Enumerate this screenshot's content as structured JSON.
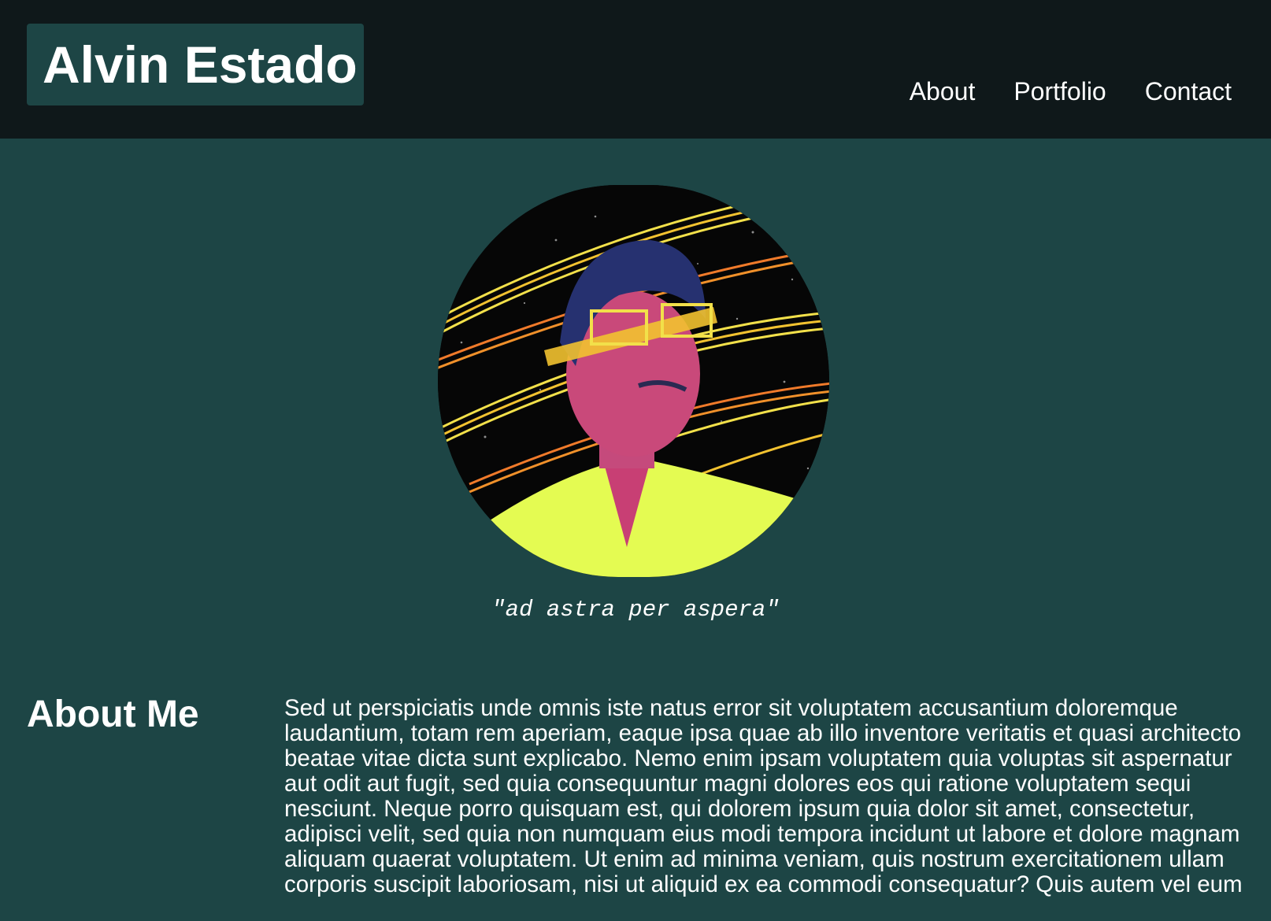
{
  "header": {
    "brand_name": "Alvin Estado",
    "nav": [
      {
        "label": "About"
      },
      {
        "label": "Portfolio"
      },
      {
        "label": "Contact"
      }
    ]
  },
  "hero": {
    "portrait_icon": "profile-portrait-image",
    "quote": "\"ad astra per aspera\""
  },
  "about": {
    "heading": "About Me",
    "body": "Sed ut perspiciatis unde omnis iste natus error sit voluptatem accusantium doloremque laudantium, totam rem aperiam, eaque ipsa quae ab illo inventore veritatis et quasi architecto beatae vitae dicta sunt explicabo. Nemo enim ipsam voluptatem quia voluptas sit aspernatur aut odit aut fugit, sed quia consequuntur magni dolores eos qui ratione voluptatem sequi nesciunt. Neque porro quisquam est, qui dolorem ipsum quia dolor sit amet, consectetur, adipisci velit, sed quia non numquam eius modi tempora incidunt ut labore et dolore magnam aliquam quaerat voluptatem. Ut enim ad minima veniam, quis nostrum exercitationem ullam corporis suscipit laboriosam, nisi ut aliquid ex ea commodi consequatur? Quis autem vel eum"
  },
  "colors": {
    "page_background": "#1d4545",
    "header_background": "#0f181a",
    "text": "#ffffff"
  }
}
